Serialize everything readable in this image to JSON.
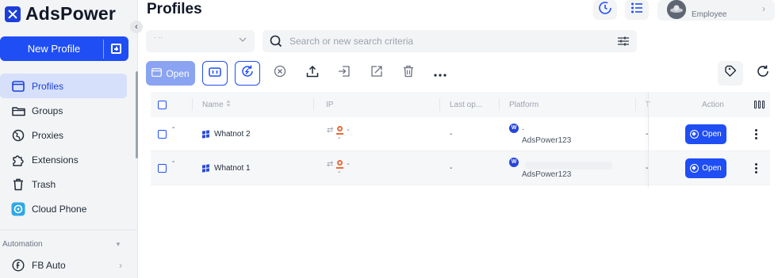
{
  "app": {
    "name": "AdsPower"
  },
  "sidebar": {
    "new_profile_label": "New Profile",
    "items": [
      {
        "label": "Profiles",
        "icon": "window-icon",
        "active": true
      },
      {
        "label": "Groups",
        "icon": "folder-icon"
      },
      {
        "label": "Proxies",
        "icon": "globe-icon"
      },
      {
        "label": "Extensions",
        "icon": "puzzle-icon"
      },
      {
        "label": "Trash",
        "icon": "trash-icon"
      },
      {
        "label": "Cloud Phone",
        "icon": "cloud-phone-icon"
      }
    ],
    "automation_label": "Automation",
    "fb_auto_label": "FB Auto"
  },
  "header": {
    "title": "Profiles",
    "user_role": "Employee"
  },
  "filters": {
    "select_value": "· ··",
    "search_placeholder": "Search or new search criteria"
  },
  "toolbar": {
    "open_label": "Open"
  },
  "table": {
    "columns": {
      "name": "Name",
      "ip": "IP",
      "last_open": "Last op...",
      "platform": "Platform",
      "tag": "T",
      "action": "Action"
    },
    "rows": [
      {
        "dash": "-",
        "name": "Whatnot 2",
        "ip_primary": "-",
        "ip_secondary": "-",
        "last_open": "-",
        "platform_badge": "W",
        "platform_top": ".",
        "platform_account": "AdsPower123",
        "tag": "-",
        "action_label": "Open"
      },
      {
        "dash": "-",
        "name": "Whatnot 1",
        "ip_primary": "-",
        "ip_secondary": "-",
        "last_open": "-",
        "platform_badge": "W",
        "platform_top": "",
        "platform_account": "AdsPower123",
        "tag": "-",
        "action_label": "Open"
      }
    ]
  },
  "colors": {
    "primary": "#1f4ef5",
    "active_nav_bg": "#d6e0fb",
    "logo": "#1c3fda",
    "proxy_pin": "#e76c3c"
  }
}
